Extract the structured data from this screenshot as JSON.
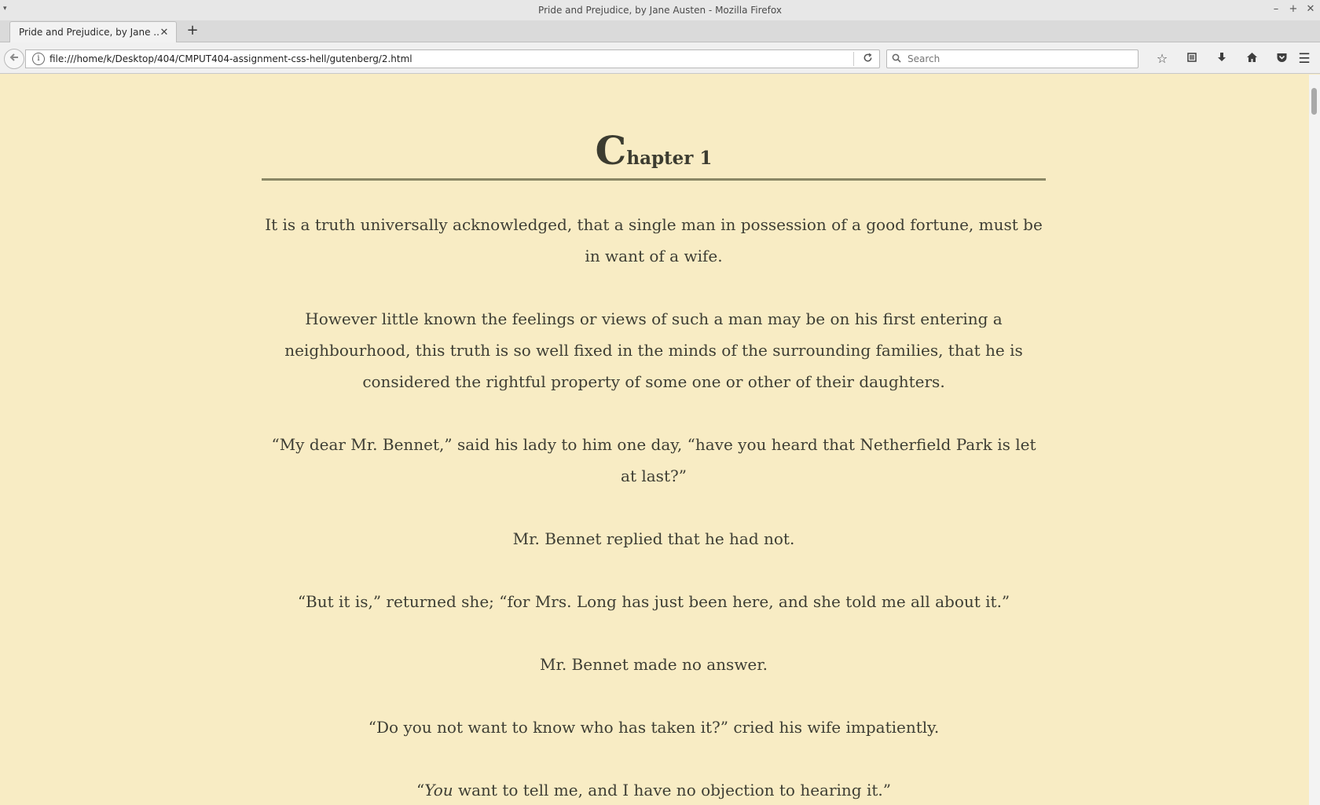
{
  "window": {
    "title": "Pride and Prejudice, by Jane Austen - Mozilla Firefox",
    "controls": {
      "minimize": "–",
      "maximize": "+",
      "close": "✕"
    }
  },
  "tabs": [
    {
      "title": "Pride and Prejudice, by Jane ...",
      "close": "✕"
    }
  ],
  "new_tab_label": "+",
  "navbar": {
    "url": "file:///home/k/Desktop/404/CMPUT404-assignment-css-hell/gutenberg/2.html",
    "search_placeholder": "Search"
  },
  "icons": {
    "back": "back-arrow-icon",
    "info": "info-icon",
    "reload": "reload-icon",
    "search": "search-icon",
    "bookmark": "star-icon",
    "reading_list": "library-icon",
    "downloads": "download-icon",
    "home": "home-icon",
    "pocket": "pocket-icon",
    "menu": "hamburger-menu-icon"
  },
  "colors": {
    "page_background": "#f8ecc4",
    "text": "#3e3e34",
    "rule": "#8a8765"
  },
  "document": {
    "chapter_dropcap": "C",
    "chapter_rest": "hapter 1",
    "paragraphs": [
      "It is a truth universally acknowledged, that a single man in possession of a good fortune, must be in want of a wife.",
      "However little known the feelings or views of such a man may be on his first entering a neighbourhood, this truth is so well fixed in the minds of the surrounding families, that he is considered the rightful property of some one or other of their daughters.",
      "“My dear Mr. Bennet,” said his lady to him one day, “have you heard that Netherfield Park is let at last?”",
      "Mr. Bennet replied that he had not.",
      "“But it is,” returned she; “for Mrs. Long has just been here, and she told me all about it.”",
      "Mr. Bennet made no answer.",
      "“Do you not want to know who has taken it?” cried his wife impatiently."
    ],
    "last_paragraph": {
      "open_quote": "“",
      "emphasis": "You",
      "rest": " want to tell me, and I have no objection to hearing it.”"
    }
  }
}
